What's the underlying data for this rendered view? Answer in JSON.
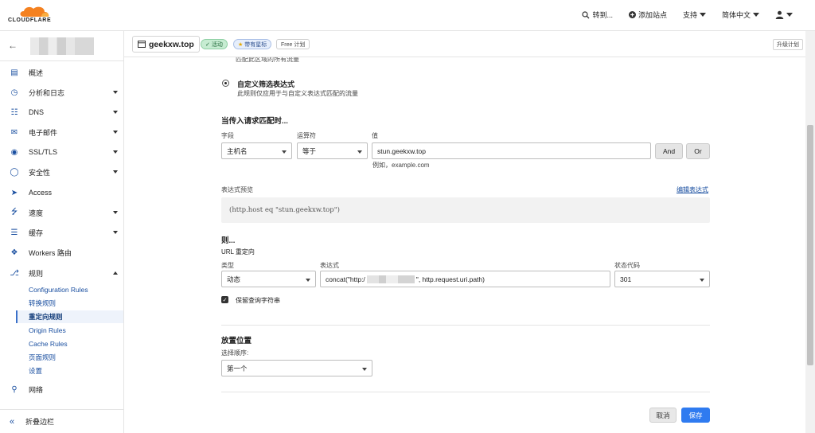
{
  "topbar": {
    "logo_text": "CLOUDFLARE",
    "goto_label": "转到...",
    "add_site_label": "添加站点",
    "support_label": "支持",
    "language_label": "简体中文"
  },
  "zone": {
    "domain": "geekxw.top",
    "status_badge": "活动",
    "star_badge": "带有星标",
    "plan_badge": "Free 计划",
    "upgrade_label": "升级计划"
  },
  "sidebar": {
    "items": [
      {
        "label": "概述",
        "icon": "document-icon"
      },
      {
        "label": "分析和日志",
        "icon": "clock-icon"
      },
      {
        "label": "DNS",
        "icon": "network-icon"
      },
      {
        "label": "电子邮件",
        "icon": "email-icon"
      },
      {
        "label": "SSL/TLS",
        "icon": "lock-icon"
      },
      {
        "label": "安全性",
        "icon": "shield-icon"
      },
      {
        "label": "Access",
        "icon": "access-icon"
      },
      {
        "label": "速度",
        "icon": "lightning-icon"
      },
      {
        "label": "缓存",
        "icon": "stack-icon"
      },
      {
        "label": "Workers 路由",
        "icon": "workers-icon"
      },
      {
        "label": "规则",
        "icon": "fork-icon"
      }
    ],
    "rules_sub": [
      {
        "label": "Configuration Rules"
      },
      {
        "label": "转换规则"
      },
      {
        "label": "重定向规则"
      },
      {
        "label": "Origin Rules"
      },
      {
        "label": "Cache Rules"
      },
      {
        "label": "页面规则"
      },
      {
        "label": "设置"
      }
    ],
    "network_label": "网络",
    "collapse_label": "折叠边栏"
  },
  "form": {
    "cut_text": "匹配此区域的所有流量",
    "radio_title": "自定义筛选表达式",
    "radio_desc": "此规则仅应用于与自定义表达式匹配的流量",
    "when_heading": "当传入请求匹配时...",
    "field_label": "字段",
    "field_value": "主机名",
    "operator_label": "运算符",
    "operator_value": "等于",
    "value_label": "值",
    "value_value": "stun.geekxw.top",
    "value_hint": "例如，example.com",
    "and_label": "And",
    "or_label": "Or",
    "preview_label": "表达式预览",
    "edit_expr_label": "编辑表达式",
    "preview_text": "(http.host eq \"stun.geekxw.top\")",
    "then_heading": "则...",
    "then_sub": "URL 重定向",
    "type_label": "类型",
    "type_value": "动态",
    "expr_label": "表达式",
    "expr_prefix": "concat(\"http:/",
    "expr_suffix": "\", http.request.uri.path)",
    "status_label": "状态代码",
    "status_value": "301",
    "preserve_label": "保留查询字符串",
    "placement_heading": "放置位置",
    "order_label": "选择顺序:",
    "order_value": "第一个",
    "cancel_label": "取消",
    "save_label": "保存"
  },
  "colors": {
    "accent_blue": "#2f7bf0",
    "link_blue": "#1a4fa0",
    "cloudflare_orange": "#f48120"
  }
}
